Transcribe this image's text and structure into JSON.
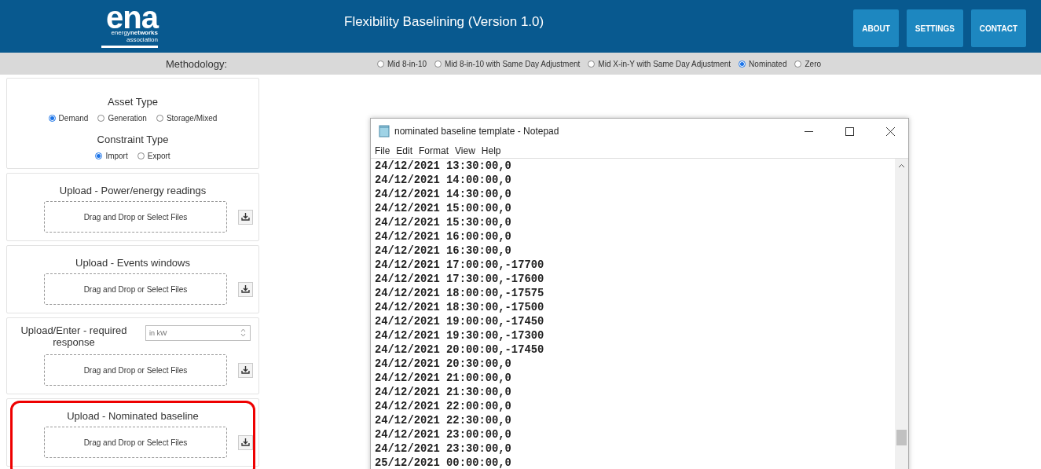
{
  "header": {
    "logo": {
      "mark": "ena",
      "line1": "energy**networks**",
      "line2": "association"
    },
    "title": "Flexibility Baselining (Version 1.0)",
    "buttons": [
      "ABOUT",
      "SETTINGS",
      "CONTACT"
    ]
  },
  "methodology": {
    "label": "Methodology:",
    "options": [
      {
        "label": "Mid 8-in-10",
        "selected": false
      },
      {
        "label": "Mid 8-in-10 with Same Day Adjustment",
        "selected": false
      },
      {
        "label": "Mid X-in-Y with Same Day Adjustment",
        "selected": false
      },
      {
        "label": "Nominated",
        "selected": true
      },
      {
        "label": "Zero",
        "selected": false
      }
    ]
  },
  "panels": [
    {
      "kind": "radios",
      "groups": [
        {
          "title": "Asset Type",
          "options": [
            {
              "label": "Demand",
              "selected": true
            },
            {
              "label": "Generation",
              "selected": false
            },
            {
              "label": "Storage/Mixed",
              "selected": false
            }
          ]
        },
        {
          "title": "Constraint Type",
          "options": [
            {
              "label": "Import",
              "selected": true
            },
            {
              "label": "Export",
              "selected": false
            }
          ]
        }
      ]
    },
    {
      "kind": "upload",
      "title": "Upload - Power/energy readings",
      "drop": "Drag and Drop or Select Files",
      "highlighted": false
    },
    {
      "kind": "upload",
      "title": "Upload - Events windows",
      "drop": "Drag and Drop or Select Files",
      "highlighted": false
    },
    {
      "kind": "upload_input",
      "title": "Upload/Enter - required response",
      "placeholder": "in kW",
      "drop": "Drag and Drop or Select Files",
      "highlighted": false
    },
    {
      "kind": "upload",
      "title": "Upload - Nominated baseline",
      "drop": "Drag and Drop or Select Files",
      "highlighted": true
    }
  ],
  "notepad": {
    "title": "nominated baseline template - Notepad",
    "menu": [
      "File",
      "Edit",
      "Format",
      "View",
      "Help"
    ],
    "lines": [
      "24/12/2021 13:30:00,0",
      "24/12/2021 14:00:00,0",
      "24/12/2021 14:30:00,0",
      "24/12/2021 15:00:00,0",
      "24/12/2021 15:30:00,0",
      "24/12/2021 16:00:00,0",
      "24/12/2021 16:30:00,0",
      "24/12/2021 17:00:00,-17700",
      "24/12/2021 17:30:00,-17600",
      "24/12/2021 18:00:00,-17575",
      "24/12/2021 18:30:00,-17500",
      "24/12/2021 19:00:00,-17450",
      "24/12/2021 19:30:00,-17300",
      "24/12/2021 20:00:00,-17450",
      "24/12/2021 20:30:00,0",
      "24/12/2021 21:00:00,0",
      "24/12/2021 21:30:00,0",
      "24/12/2021 22:00:00,0",
      "24/12/2021 22:30:00,0",
      "24/12/2021 23:00:00,0",
      "24/12/2021 23:30:00,0",
      "25/12/2021 00:00:00,0"
    ]
  }
}
